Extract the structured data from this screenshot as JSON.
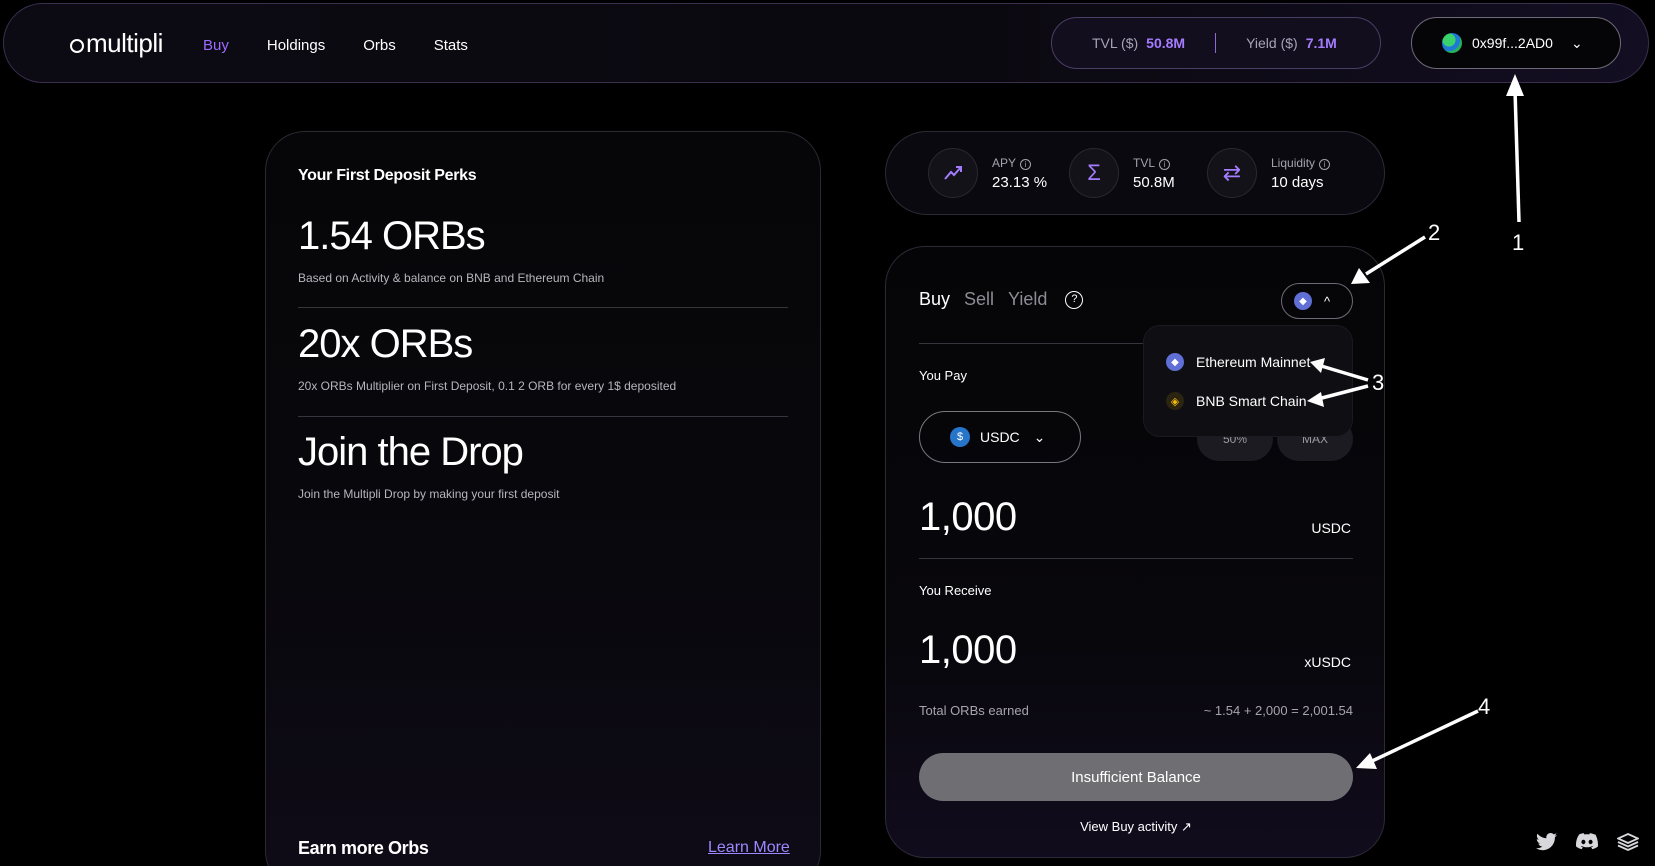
{
  "nav": {
    "logo": "multipli",
    "links": [
      "Buy",
      "Holdings",
      "Orbs",
      "Stats"
    ]
  },
  "header_stats": {
    "tvl_label": "TVL ($)",
    "tvl_value": "50.8M",
    "yield_label": "Yield ($)",
    "yield_value": "7.1M"
  },
  "wallet": {
    "address": "0x99f...2AD0"
  },
  "perks": {
    "title": "Your First Deposit Perks",
    "items": [
      {
        "heading": "1.54 ORBs",
        "desc": "Based on Activity & balance on BNB and Ethereum Chain"
      },
      {
        "heading": "20x ORBs",
        "desc": "20x ORBs Multiplier on First Deposit, 0.1 2 ORB for every 1$ deposited"
      },
      {
        "heading": "Join the Drop",
        "desc": "Join the Multipli Drop by making your first deposit"
      }
    ],
    "earn_more": "Earn more Orbs",
    "learn_more": "Learn More"
  },
  "metrics": [
    {
      "label": "APY",
      "value": "23.13 %",
      "icon": "trend-up-icon"
    },
    {
      "label": "TVL",
      "value": "50.8M",
      "icon": "sigma-icon"
    },
    {
      "label": "Liquidity",
      "value": "10 days",
      "icon": "swap-arrows-icon"
    }
  ],
  "trade": {
    "tabs": [
      "Buy",
      "Sell",
      "Yield"
    ],
    "you_pay": "You Pay",
    "token": "USDC",
    "pct_buttons": [
      "50%",
      "MAX"
    ],
    "pay_amount": "1,000",
    "pay_unit": "USDC",
    "you_receive": "You Receive",
    "receive_amount": "1,000",
    "receive_unit": "xUSDC",
    "orbs_label": "Total ORBs earned",
    "orbs_value": "~ 1.54 + 2,000 = 2,001.54",
    "cta": "Insufficient Balance",
    "activity": "View Buy activity ↗"
  },
  "chain_dropdown": {
    "options": [
      "Ethereum Mainnet",
      "BNB Smart Chain"
    ]
  },
  "annotations": [
    "1",
    "2",
    "3",
    "4"
  ]
}
